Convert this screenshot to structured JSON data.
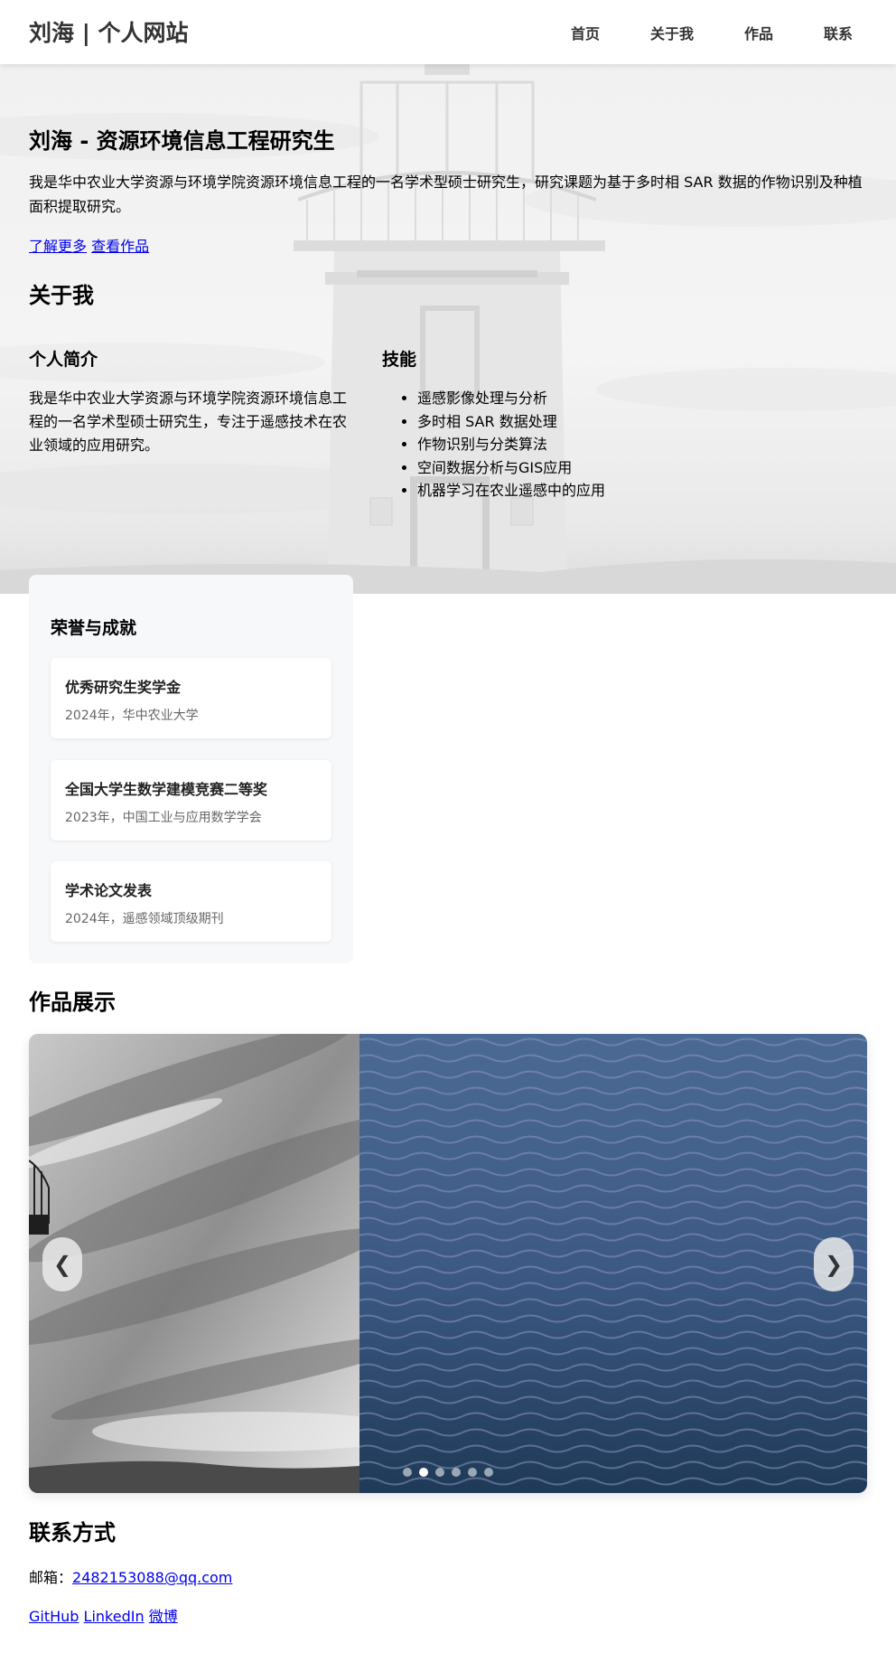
{
  "site": {
    "brand": "刘海 | 个人网站",
    "nav": [
      "首页",
      "关于我",
      "作品",
      "联系"
    ]
  },
  "hero": {
    "title": "刘海 - 资源环境信息工程研究生",
    "description": "我是华中农业大学资源与环境学院资源环境信息工程的一名学术型硕士研究生，研究课题为基于多时相 SAR 数据的作物识别及种植面积提取研究。",
    "learn_more": "了解更多",
    "view_works": "查看作品"
  },
  "about": {
    "title": "关于我",
    "intro_title": "个人简介",
    "intro_text": "我是华中农业大学资源与环境学院资源环境信息工程的一名学术型硕士研究生，专注于遥感技术在农业领域的应用研究。",
    "skills_title": "技能",
    "skills": [
      "遥感影像处理与分析",
      "多时相 SAR 数据处理",
      "作物识别与分类算法",
      "空间数据分析与GIS应用",
      "机器学习在农业遥感中的应用"
    ]
  },
  "honors": {
    "title": "荣誉与成就",
    "items": [
      {
        "name": "优秀研究生奖学金",
        "meta": "2024年，华中农业大学"
      },
      {
        "name": "全国大学生数学建模竞赛二等奖",
        "meta": "2023年，中国工业与应用数学学会"
      },
      {
        "name": "学术论文发表",
        "meta": "2024年，遥感领域顶级期刊"
      }
    ]
  },
  "works": {
    "title": "作品展示",
    "prev_arrow": "❮",
    "next_arrow": "❯",
    "slide_count": 6,
    "active_slide": 2
  },
  "contact": {
    "title": "联系方式",
    "email_label": "邮箱：",
    "email": "2482153088@qq.com",
    "links": [
      "GitHub",
      "LinkedIn",
      "微博"
    ]
  }
}
